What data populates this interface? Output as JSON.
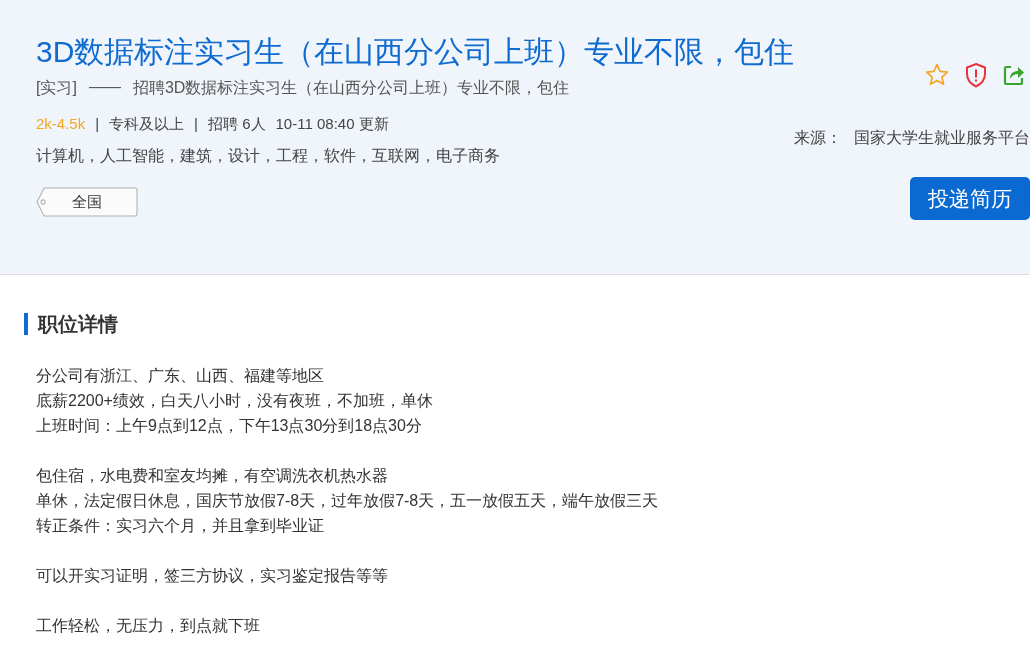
{
  "job": {
    "title": "3D数据标注实习生（在山西分公司上班）专业不限，包住",
    "type": "[实习]",
    "dash": "——",
    "subtitle": "招聘3D数据标注实习生（在山西分公司上班）专业不限，包住",
    "meta": [
      {
        "kind": "salary",
        "text": "2k-4.5k"
      },
      {
        "kind": "sep",
        "text": "|"
      },
      {
        "kind": "text",
        "text": "专科及以上"
      },
      {
        "kind": "sep",
        "text": "|"
      },
      {
        "kind": "text",
        "text": "招聘 6人"
      },
      {
        "kind": "text",
        "text": "10-11 08:40 更新"
      }
    ],
    "majors": "计算机，人工智能，建筑，设计，工程，软件，互联网，电子商务",
    "location": "全国",
    "source_label": "来源：",
    "source": "国家大学生就业服务平台",
    "apply_button": "投递简历"
  },
  "details": {
    "heading": "职位详情",
    "paragraphs": [
      [
        "分公司有浙江、广东、山西、福建等地区",
        "底薪2200+绩效，白天八小时，没有夜班，不加班，单休",
        "上班时间：上午9点到12点，下午13点30分到18点30分"
      ],
      [
        "包住宿，水电费和室友均摊，有空调洗衣机热水器",
        "单休，法定假日休息，国庆节放假7-8天，过年放假7-8天，五一放假五天，端午放假三天",
        "转正条件：实习六个月，并且拿到毕业证"
      ],
      [
        "可以开实习证明，签三方协议，实习鉴定报告等等"
      ],
      [
        "工作轻松，无压力，到点就下班"
      ]
    ]
  }
}
